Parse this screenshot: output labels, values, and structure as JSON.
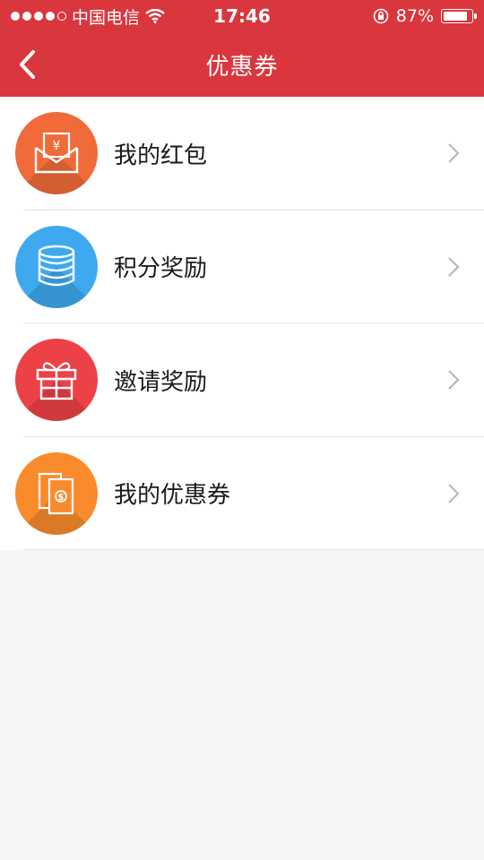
{
  "status_bar": {
    "carrier": "中国电信",
    "time": "17:46",
    "battery": "87%",
    "battery_level": 0.87
  },
  "nav": {
    "title": "优惠券",
    "back_icon": "chevron-left-icon"
  },
  "menu": [
    {
      "label": "我的红包",
      "icon": "red-envelope-icon",
      "color": "#f16b3a"
    },
    {
      "label": "积分奖励",
      "icon": "coins-stack-icon",
      "color": "#3fa9f0"
    },
    {
      "label": "邀请奖励",
      "icon": "gift-icon",
      "color": "#ec4146"
    },
    {
      "label": "我的优惠券",
      "icon": "coupon-icon",
      "color": "#f98b2c"
    }
  ],
  "colors": {
    "brand": "#d9363e",
    "divider": "#e3e3e3",
    "chevron": "#b8b8b8"
  }
}
